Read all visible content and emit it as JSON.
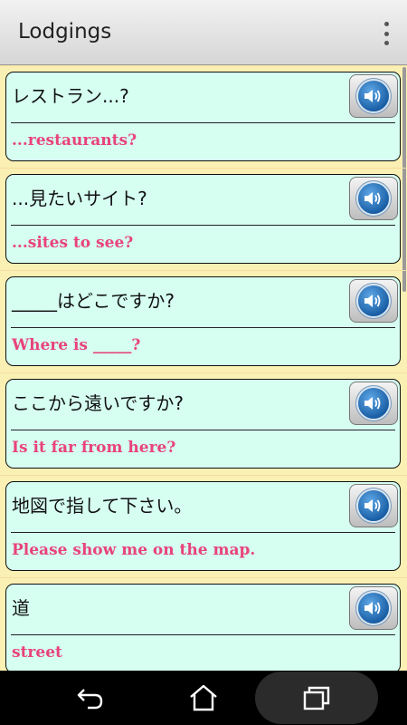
{
  "app_bar": {
    "title": "Lodgings",
    "menu_icon": "overflow-menu-icon"
  },
  "phrases": [
    {
      "japanese": "レストラン...?",
      "english": "...restaurants?"
    },
    {
      "japanese": "...見たいサイト?",
      "english": "...sites to see?"
    },
    {
      "japanese": "_____はどこですか?",
      "english": "Where is _____?"
    },
    {
      "japanese": "ここから遠いですか?",
      "english": "Is it far from here?"
    },
    {
      "japanese": "地図で指して下さい。",
      "english": "Please show me on the map."
    },
    {
      "japanese": "道",
      "english": "street"
    }
  ],
  "speaker_icon": "speaker-icon",
  "nav_bar": {
    "back_icon": "back-icon",
    "home_icon": "home-icon",
    "recents_icon": "recent-apps-icon"
  },
  "colors": {
    "background": "#fbf0b4",
    "card": "#d6fff2",
    "english_text": "#e8437a",
    "speaker_blue": "#1a5fa6"
  }
}
